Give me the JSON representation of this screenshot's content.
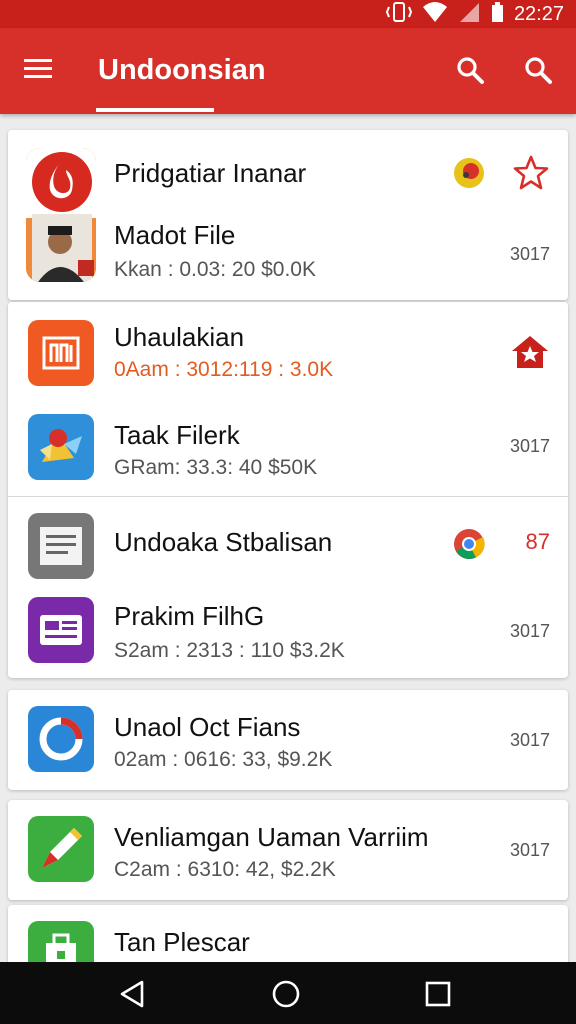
{
  "status_bar": {
    "time": "22:27",
    "icons": [
      "vibrate-icon",
      "wifi-icon",
      "signal-icon",
      "battery-icon"
    ]
  },
  "app_bar": {
    "title": "Undoonsian",
    "icons": [
      "menu-icon",
      "search-icon",
      "search-icon"
    ]
  },
  "list": {
    "items": [
      {
        "title": "Pridgatiar Inanar",
        "sub": "",
        "meta": "",
        "icon": "flame-icon"
      },
      {
        "title": "Madot File",
        "sub": "Kkan : 0.03: 20 $0.0K",
        "meta": "3017",
        "icon": "person-photo-icon"
      },
      {
        "title": "Uhaulakian",
        "sub": "0Aam : 3012:119 : 3.0K",
        "meta": "",
        "icon": "app-icon"
      },
      {
        "title": "Taak Filerk",
        "sub": "GRam: 33.3: 40 $50K",
        "meta": "3017",
        "icon": "bird-icon"
      },
      {
        "title": "Undoaka Stbalisan",
        "sub": "",
        "meta": "87",
        "icon": "document-icon"
      },
      {
        "title": "Prakim FilhG",
        "sub": "S2am : 2313 : 110 $3.2K",
        "meta": "3017",
        "icon": "card-icon"
      },
      {
        "title": "Unaol Oct Fians",
        "sub": "02am : 0616: 33, $9.2K",
        "meta": "3017",
        "icon": "ring-icon"
      },
      {
        "title": "Venliamgan Uaman Varriim",
        "sub": "C2am : 6310: 42, $2.2K",
        "meta": "3017",
        "icon": "pencil-icon"
      },
      {
        "title": "Tan Plescar",
        "sub": "",
        "meta": "",
        "icon": "bag-icon"
      }
    ]
  },
  "nav_bar": {
    "icons": [
      "back-icon",
      "home-icon",
      "recents-icon"
    ]
  },
  "colors": {
    "primary": "#d7302a",
    "status_bar": "#c8201b",
    "accent_orange": "#f05a22",
    "text": "#111111"
  }
}
